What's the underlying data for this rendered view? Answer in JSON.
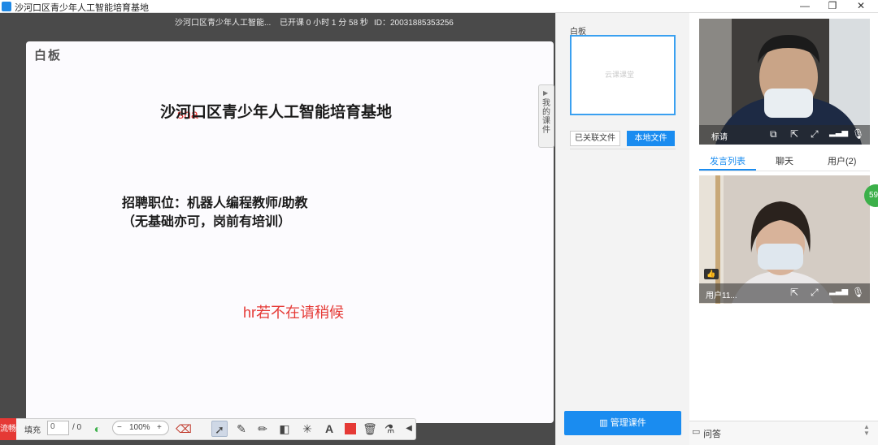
{
  "window": {
    "title": "沙河口区青少年人工智能培育基地",
    "controls": {
      "minimize": "—",
      "maximize": "❐",
      "close": "✕"
    }
  },
  "info_bar": {
    "room_name": "沙河口区青少年人工智能...",
    "duration": "已开课 0 小时 1 分 58 秒",
    "id": "ID：20031885353256"
  },
  "whiteboard": {
    "label": "白板",
    "lines": {
      "title": "沙河口区青少年人工智能培育基地",
      "title_overlay": "sha",
      "job": "招聘职位：机器人编程教师/助教",
      "note": "（无基础亦可，岗前有培训）",
      "hr": "hr若不在请稍候"
    }
  },
  "toolbar": {
    "left_tag": "流畅",
    "fill_label": "填充",
    "fill_value": "0",
    "page_total": "/ 0",
    "zoom": "100%",
    "zoom_minus": "−",
    "zoom_plus": "+"
  },
  "courseware": {
    "whiteboard_title": "白板",
    "thumb_logo": "云课课堂",
    "side_tab": "我的课件",
    "tab_linked": "已关联文件",
    "tab_local": "本地文件",
    "manage_button": "管理课件"
  },
  "participants": {
    "teacher_name": "标请",
    "tabs": [
      "发言列表",
      "聊天",
      "用户(2)"
    ],
    "student_name": "用户11...",
    "badge": "59"
  },
  "qa": {
    "label": "问答"
  },
  "colors": {
    "accent": "#1a8cf0",
    "annotation_red": "#e53935",
    "stage": "#4a4a4a"
  }
}
